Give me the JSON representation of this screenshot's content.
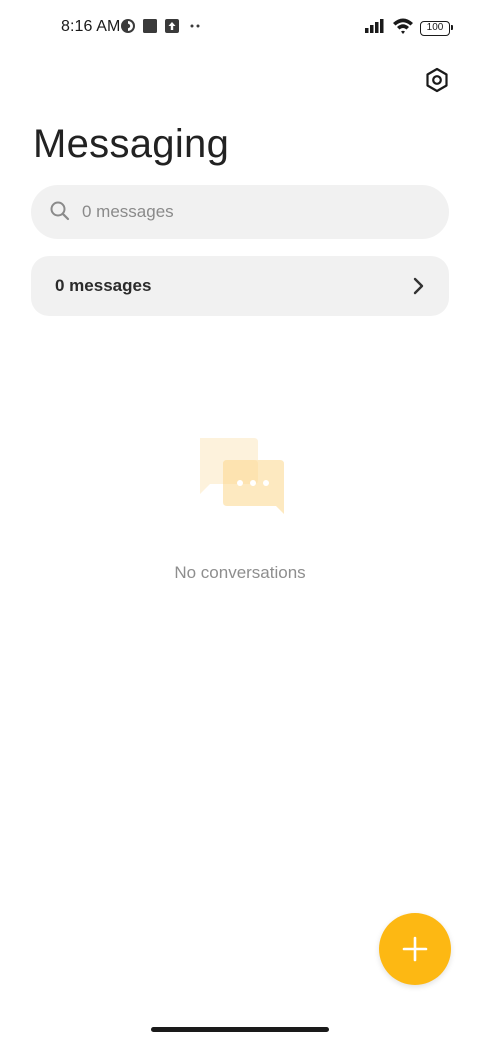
{
  "status_bar": {
    "time": "8:16 AM",
    "battery_level": "100",
    "left_icons": [
      "data-saver-icon",
      "square-notification-icon",
      "upload-notification-icon",
      "more-notifications-icon"
    ],
    "right_icons": [
      "signal-icon",
      "wifi-icon",
      "battery-icon"
    ]
  },
  "header": {
    "title": "Messaging",
    "settings_icon": "gear-icon"
  },
  "search": {
    "placeholder": "0 messages",
    "icon": "search-icon"
  },
  "messages_row": {
    "label": "0 messages",
    "icon": "chevron-right-icon"
  },
  "empty_state": {
    "illustration": "chat-bubbles-icon",
    "text": "No conversations"
  },
  "fab": {
    "icon": "plus-icon",
    "color": "#fdb813"
  },
  "colors": {
    "accent": "#fdb813",
    "surface": "#f1f1f1",
    "text_secondary": "#8e8e8e"
  }
}
